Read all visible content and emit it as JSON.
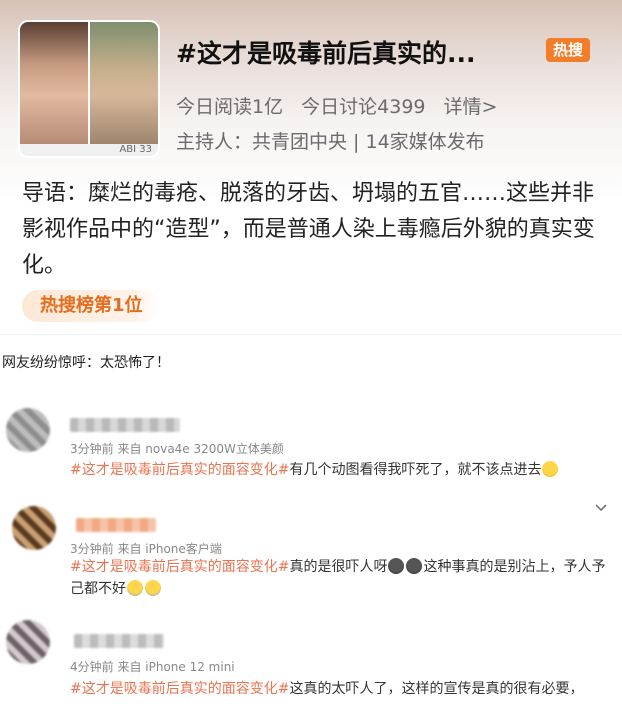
{
  "topic": {
    "title": "#这才是吸毒前后真实的...",
    "hot_badge": "热搜",
    "reads": "今日阅读1亿",
    "discussions": "今日讨论4399",
    "details": "详情>",
    "host": "主持人：共青团中央 | 14家媒体发布",
    "thumb_watermark": "ABI 33",
    "intro": "导语：糜烂的毒疮、脱落的牙齿、坍塌的五官……这些并非影视作品中的“造型”，而是普通人染上毒瘾后外貌的真实变化。",
    "rank": "热搜榜第1位"
  },
  "subheading": "网友纷纷惊呼：太恐怖了！",
  "comments": [
    {
      "meta": "3分钟前  来自 nova4e 3200W立体美颜",
      "tag": "#这才是吸毒前后真实的面容变化#",
      "text": "有几个动图看得我吓死了，就不该点进去",
      "emoji": "laugh-cry-emoji"
    },
    {
      "meta": "3分钟前  来自 iPhone客户端",
      "tag": "#这才是吸毒前后真实的面容变化#",
      "text_a": "真的是很吓人呀",
      "text_b": "这种事真的是别沾上，予人予",
      "text_c": "己都不好",
      "emoji": "crying-emoji"
    },
    {
      "meta": "4分钟前  来自 iPhone 12 mini",
      "tag": "#这才是吸毒前后真实的面容变化#",
      "text": "这真的太吓人了，这样的宣传是真的很有必要，"
    }
  ],
  "colors": {
    "hot_badge": "#f47d2a",
    "tag_link": "#eb7350",
    "rank_text": "#e56d1f"
  },
  "icons": {
    "expand": "chevron-down-icon"
  }
}
